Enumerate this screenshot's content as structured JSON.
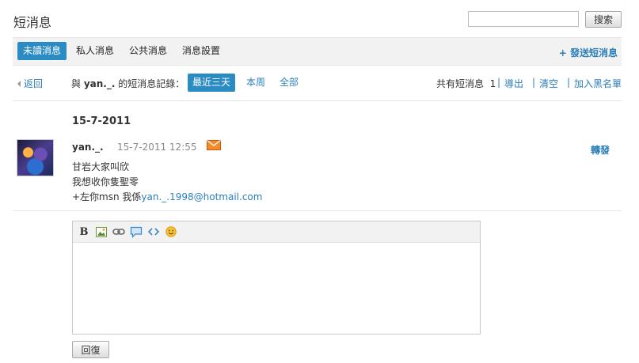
{
  "header": {
    "title": "短消息",
    "search_placeholder": "",
    "search_button": "搜索"
  },
  "tabs": [
    {
      "label": "未讀消息",
      "active": true
    },
    {
      "label": "私人消息",
      "active": false
    },
    {
      "label": "公共消息",
      "active": false
    },
    {
      "label": "消息設置",
      "active": false
    }
  ],
  "compose_label": "+ 發送短消息",
  "filter_bar": {
    "back_label": "返回",
    "record_prefix": "與",
    "record_user": "yan._.",
    "record_suffix": "的短消息記錄：",
    "filters": [
      {
        "label": "最近三天",
        "active": true
      },
      {
        "label": "本周",
        "active": false
      },
      {
        "label": "全部",
        "active": false
      }
    ],
    "total_label": "共有短消息",
    "total_count": "1",
    "actions": [
      "導出",
      "清空",
      "加入黑名單"
    ]
  },
  "message_group": {
    "date": "15-7-2011",
    "sender": "yan._.",
    "timestamp": "15-7-2011 12:55",
    "forward_label": "轉發",
    "lines": [
      "甘岩大家叫欣",
      "我想收你隻聖零"
    ],
    "last_line_prefix": "+左你msn 我係",
    "last_line_link": "yan._.1998@hotmail.com"
  },
  "editor": {
    "toolbar_icons": [
      "bold-icon",
      "image-icon",
      "link-icon",
      "quote-icon",
      "code-icon",
      "smiley-icon"
    ],
    "reply_button": "回復"
  },
  "colors": {
    "accent": "#2b8cc4",
    "link": "#2b7fb7",
    "mail_icon": "#f07a1a"
  }
}
